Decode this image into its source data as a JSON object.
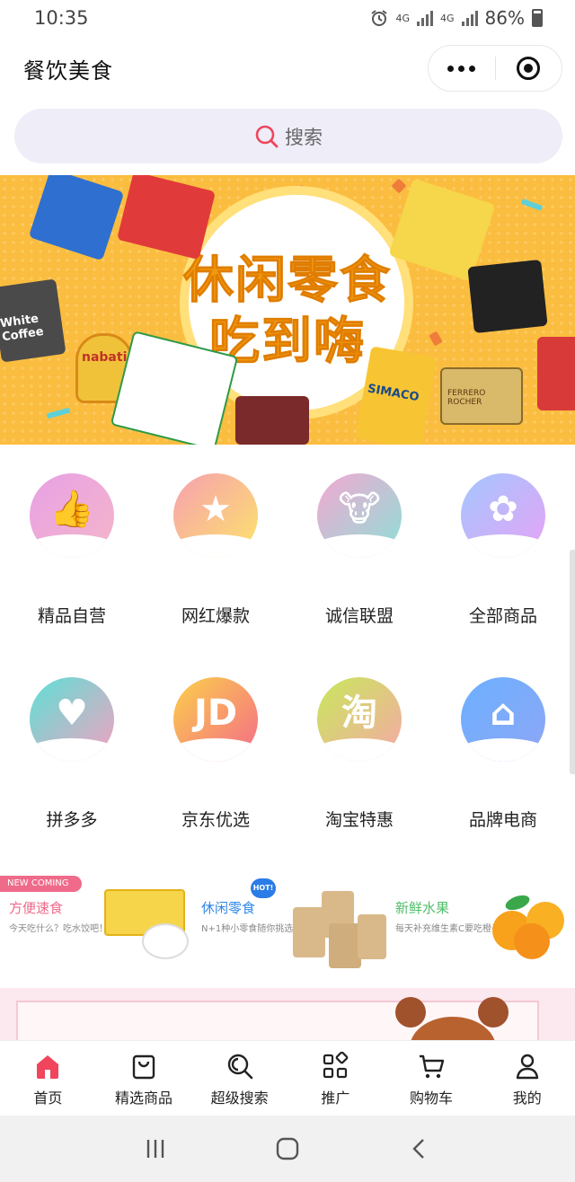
{
  "status_bar": {
    "time": "10:35",
    "network1": "4G",
    "network2": "4G",
    "battery": "86%"
  },
  "nav": {
    "title": "餐饮美食",
    "menu_icon": "more-dots-icon",
    "close_icon": "target-circle-icon"
  },
  "search": {
    "label": "搜索",
    "icon": "search-icon"
  },
  "banner": {
    "line1": "休闲零食",
    "line2": "吃到嗨",
    "brand_a": "nabati",
    "brand_b": "White Coffee",
    "brand_c": "SIMACO",
    "brand_d": "FERRERO ROCHER"
  },
  "categories": [
    {
      "label": "精品自营",
      "icon": "thumbs-up-icon",
      "glyph": "👍",
      "colors": [
        "#e7a1e5",
        "#f5b6c9"
      ]
    },
    {
      "label": "网红爆款",
      "icon": "star-icon",
      "glyph": "★",
      "colors": [
        "#f6a0b0",
        "#fde46a"
      ]
    },
    {
      "label": "诚信联盟",
      "icon": "mascot-icon",
      "glyph": "🐮",
      "colors": [
        "#f3a8d2",
        "#8de0d6"
      ]
    },
    {
      "label": "全部商品",
      "icon": "flower-icon",
      "glyph": "✿",
      "colors": [
        "#a3c6ff",
        "#e7a3f5"
      ]
    },
    {
      "label": "拼多多",
      "icon": "pinduoduo-heart-icon",
      "glyph": "♥",
      "colors": [
        "#5ce0d6",
        "#f6a0c0"
      ]
    },
    {
      "label": "京东优选",
      "icon": "jd-icon",
      "glyph": "JD",
      "colors": [
        "#fbd04a",
        "#f56a8a"
      ]
    },
    {
      "label": "淘宝特惠",
      "icon": "taobao-icon",
      "glyph": "淘",
      "colors": [
        "#c8e85a",
        "#f6a8a8"
      ]
    },
    {
      "label": "品牌电商",
      "icon": "store-icon",
      "glyph": "⌂",
      "colors": [
        "#6bb0ff",
        "#8ea6f5"
      ]
    }
  ],
  "promo": {
    "tag": "NEW COMING",
    "hot": "HOT!",
    "items": [
      {
        "title": "方便速食",
        "sub": "今天吃什么？吃水饺吧！",
        "color": "#f0698a"
      },
      {
        "title": "休闲零食",
        "sub": "N+1种小零食随你挑选",
        "color": "#2f86e8"
      },
      {
        "title": "新鲜水果",
        "sub": "每天补充维生素C要吃橙子",
        "color": "#4fbf6a"
      }
    ]
  },
  "tabs": [
    {
      "label": "首页",
      "icon": "home-icon",
      "active": true
    },
    {
      "label": "精选商品",
      "icon": "shopping-bag-icon"
    },
    {
      "label": "超级搜索",
      "icon": "super-search-icon"
    },
    {
      "label": "推广",
      "icon": "apps-grid-icon"
    },
    {
      "label": "购物车",
      "icon": "cart-icon"
    },
    {
      "label": "我的",
      "icon": "user-icon"
    }
  ],
  "colors": {
    "accent": "#f0455c",
    "search_bg": "#eeedf8",
    "banner_bg": "#fbbd3f"
  }
}
